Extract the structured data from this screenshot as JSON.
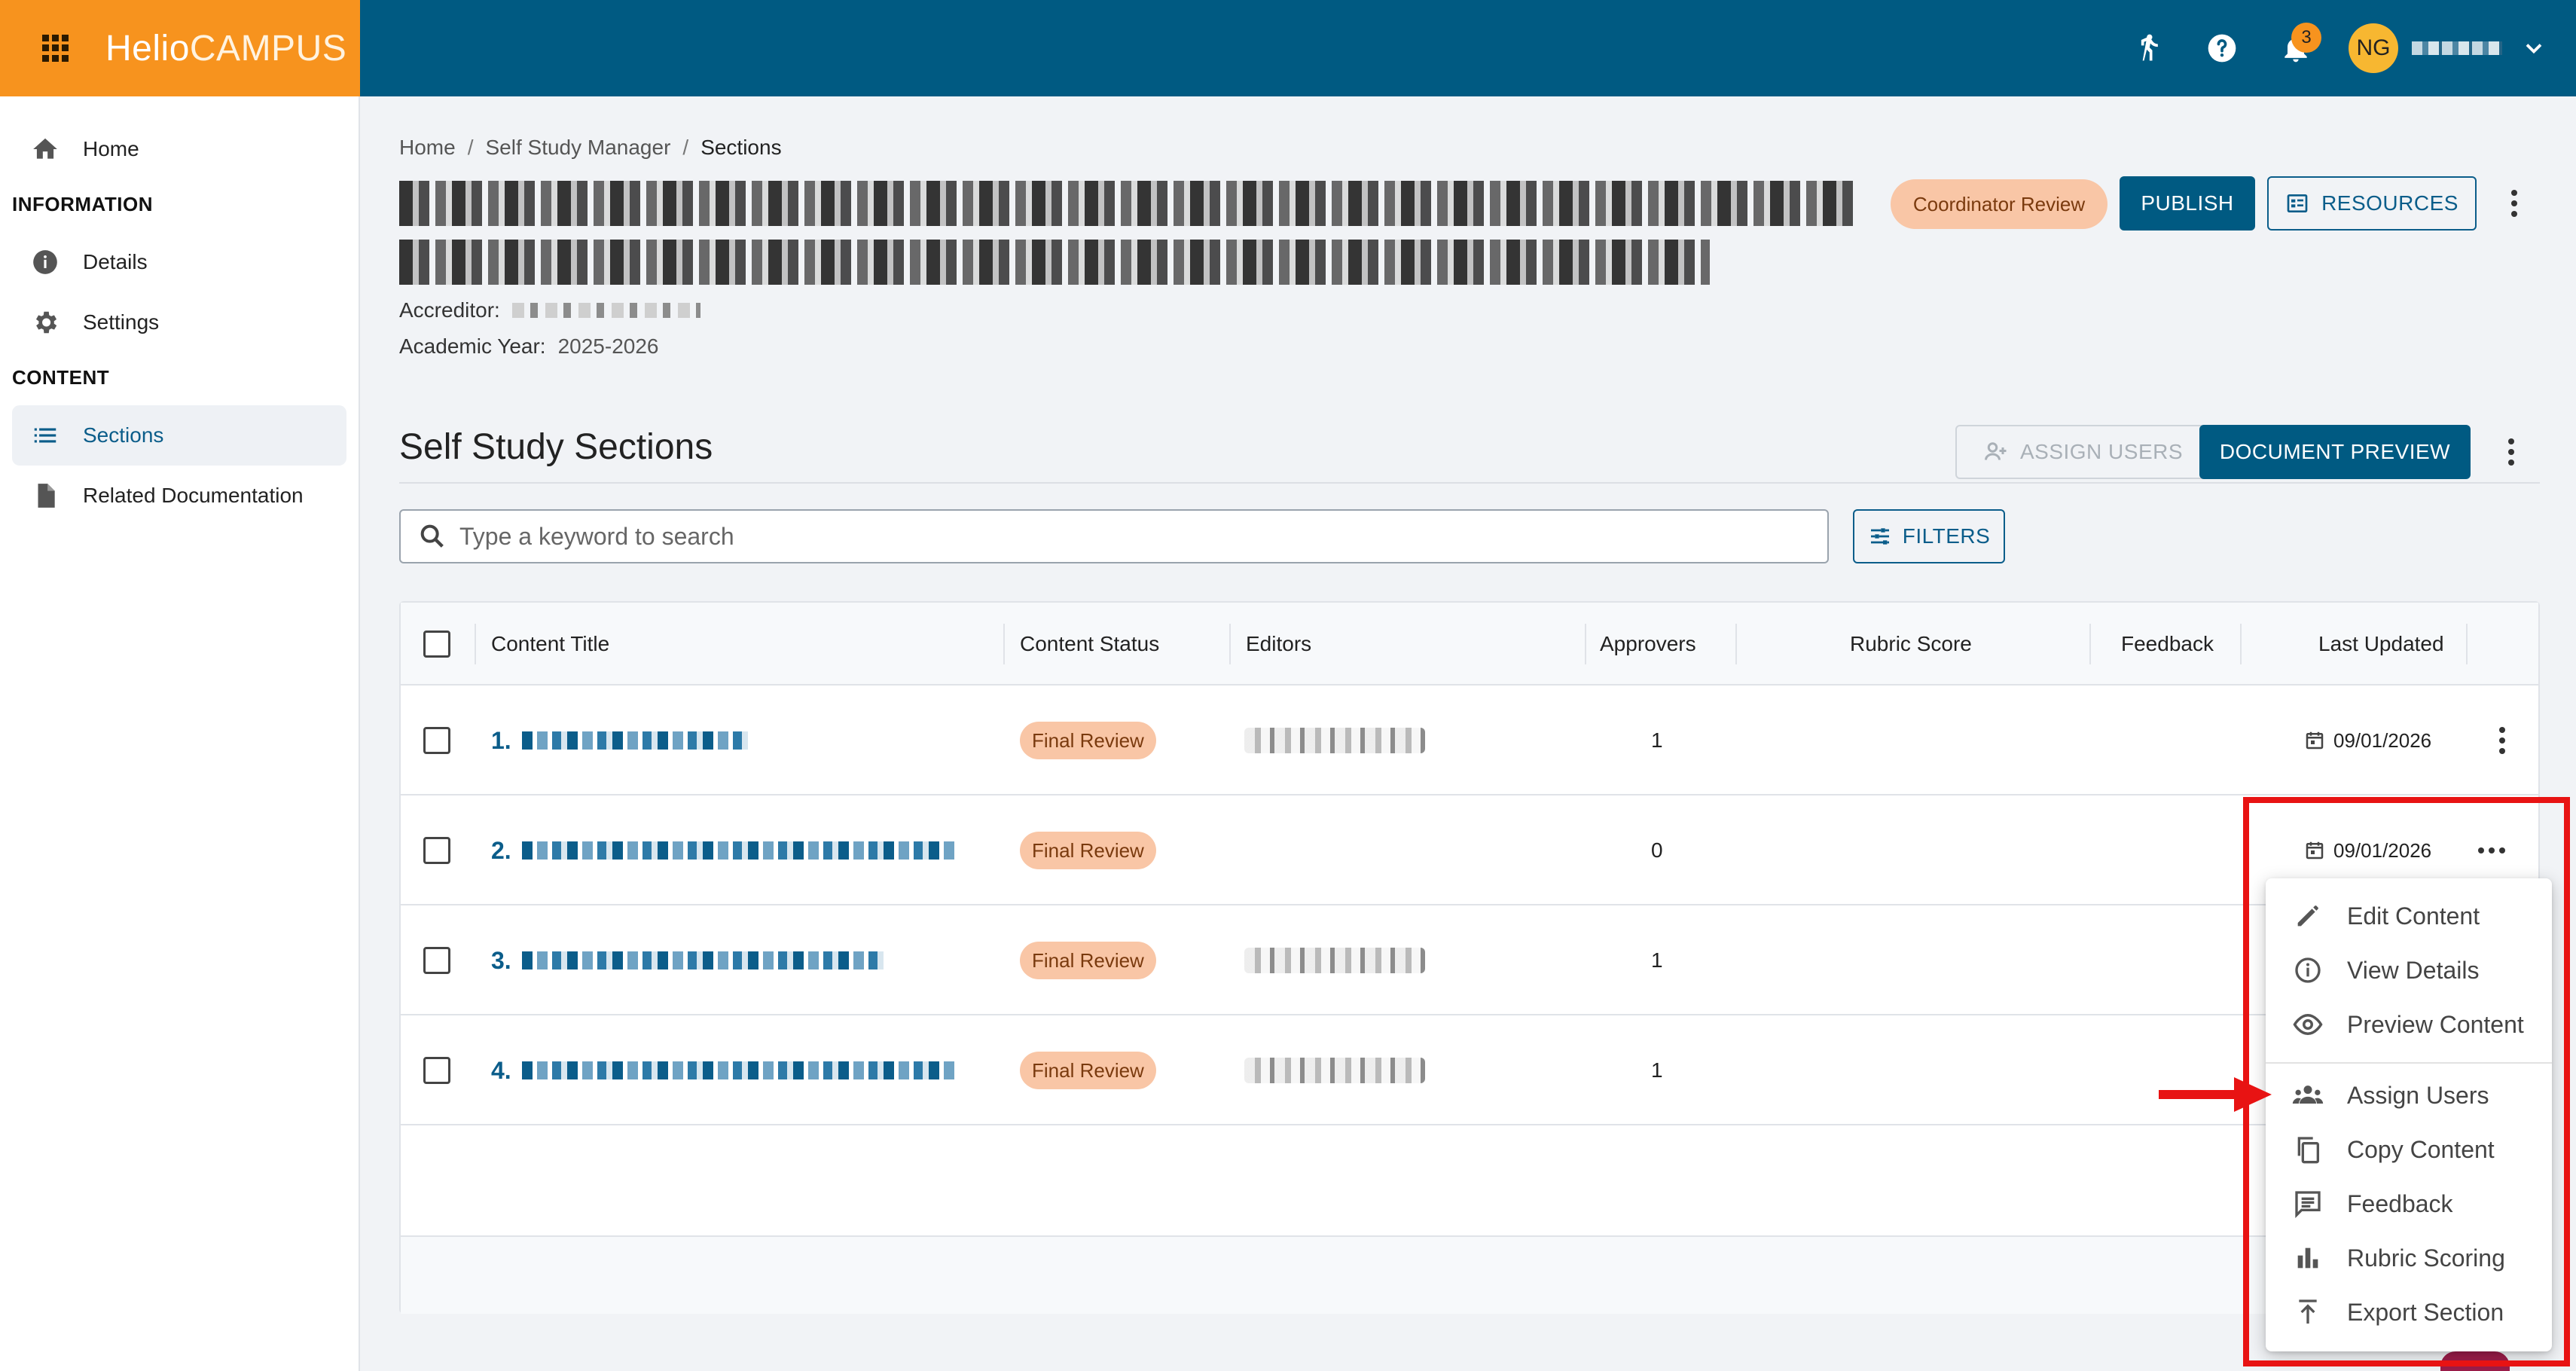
{
  "topbar": {
    "logo_primary": "Helio",
    "logo_secondary": "CAMPUS",
    "notification_count": "3",
    "user_initials": "NG"
  },
  "sidebar": {
    "home": "Home",
    "section_information": "INFORMATION",
    "details": "Details",
    "settings": "Settings",
    "section_content": "CONTENT",
    "sections": "Sections",
    "related_documentation": "Related Documentation"
  },
  "breadcrumb": {
    "home": "Home",
    "manager": "Self Study Manager",
    "current": "Sections",
    "separator": "/"
  },
  "header": {
    "accreditor_label": "Accreditor:",
    "academic_year_label": "Academic Year:",
    "academic_year_value": "2025-2026",
    "status_pill": "Coordinator Review",
    "publish_label": "PUBLISH",
    "resources_label": "RESOURCES"
  },
  "sections_panel": {
    "title": "Self Study Sections",
    "assign_users_label": "ASSIGN USERS",
    "document_preview_label": "DOCUMENT PREVIEW",
    "search_placeholder": "Type a keyword to search",
    "filters_label": "FILTERS"
  },
  "table": {
    "columns": [
      "Content Title",
      "Content Status",
      "Editors",
      "Approvers",
      "Rubric Score",
      "Feedback",
      "Last Updated"
    ],
    "rows": [
      {
        "number": "1.",
        "status": "Final Review",
        "approvers": "1",
        "last_updated": "09/01/2026",
        "has_editor": true
      },
      {
        "number": "2.",
        "status": "Final Review",
        "approvers": "0",
        "last_updated": "09/01/2026",
        "has_editor": false
      },
      {
        "number": "3.",
        "status": "Final Review",
        "approvers": "1",
        "last_updated": "",
        "has_editor": true
      },
      {
        "number": "4.",
        "status": "Final Review",
        "approvers": "1",
        "last_updated": "",
        "has_editor": true
      }
    ]
  },
  "context_menu": {
    "items": [
      {
        "label": "Edit Content",
        "icon": "pencil-icon"
      },
      {
        "label": "View Details",
        "icon": "info-icon"
      },
      {
        "label": "Preview Content",
        "icon": "eye-icon"
      },
      {
        "label": "Assign Users",
        "icon": "people-icon"
      },
      {
        "label": "Copy Content",
        "icon": "copy-icon"
      },
      {
        "label": "Feedback",
        "icon": "comment-icon"
      },
      {
        "label": "Rubric Scoring",
        "icon": "bar-chart-icon"
      },
      {
        "label": "Export Section",
        "icon": "export-icon"
      }
    ]
  },
  "colors": {
    "topbar": "#005a82",
    "brand": "#f7931e",
    "primary": "#005a82",
    "status_pill": "#f9c6a6",
    "highlight": "#e81313"
  }
}
